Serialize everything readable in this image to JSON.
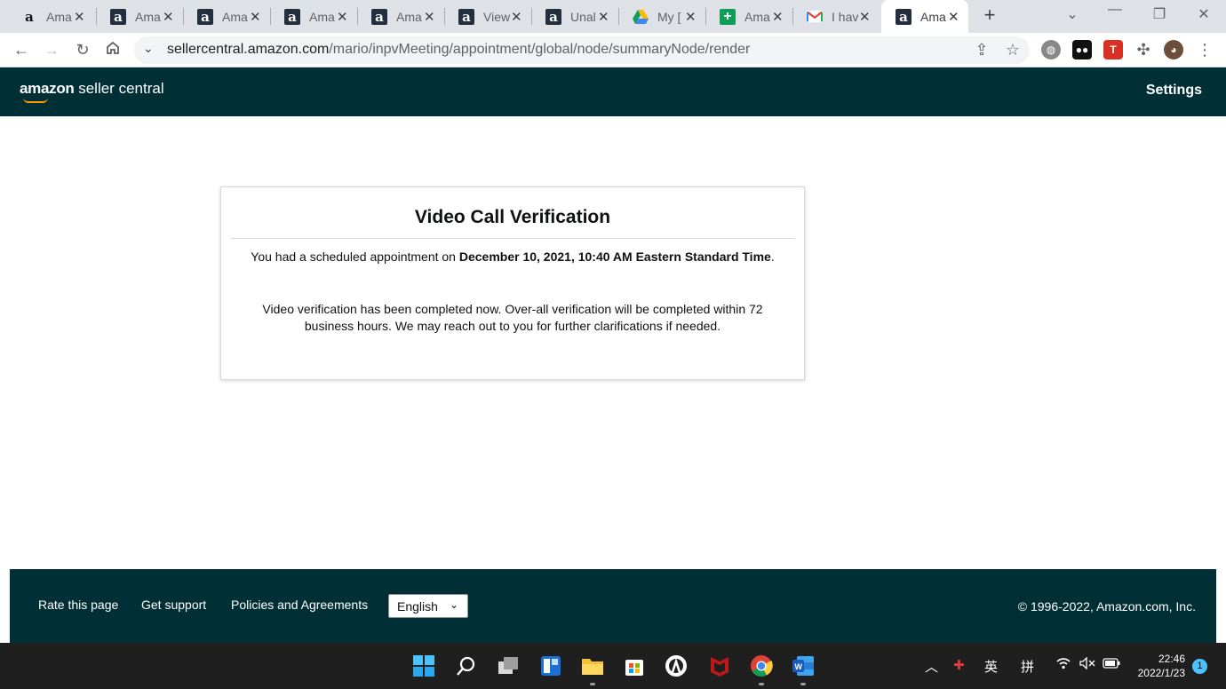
{
  "browser": {
    "tabs": [
      {
        "title": "Ama",
        "icon": "amazon-icon"
      },
      {
        "title": "Ama",
        "icon": "amazon-icon"
      },
      {
        "title": "Ama",
        "icon": "amazon-icon"
      },
      {
        "title": "Ama",
        "icon": "amazon-icon"
      },
      {
        "title": "Ama",
        "icon": "amazon-icon"
      },
      {
        "title": "View",
        "icon": "amazon-icon"
      },
      {
        "title": "Unal",
        "icon": "amazon-icon"
      },
      {
        "title": "My [",
        "icon": "google-drive-icon"
      },
      {
        "title": "Ama",
        "icon": "google-sheets-icon"
      },
      {
        "title": "I hav",
        "icon": "gmail-icon"
      },
      {
        "title": "Ama",
        "icon": "amazon-icon"
      }
    ],
    "url_host": "sellercentral.amazon.com",
    "url_path": "/mario/inpvMeeting/appointment/global/node/summaryNode/render"
  },
  "header": {
    "logo_bold": "amazon",
    "logo_rest": " seller central",
    "settings_label": "Settings"
  },
  "card": {
    "title": "Video Call Verification",
    "p1_prefix": "You had a scheduled appointment on ",
    "p1_bold": "December 10, 2021, 10:40 AM Eastern Standard Time",
    "p1_suffix": ".",
    "p2": "Video verification has been completed now. Over-all verification will be completed within 72 business hours. We may reach out to you for further clarifications if needed."
  },
  "footer": {
    "rate": "Rate this page",
    "support": "Get support",
    "policies": "Policies and Agreements",
    "language": "English",
    "copyright": "© 1996-2022, Amazon.com, Inc."
  },
  "taskbar": {
    "ime_1": "英",
    "ime_2": "拼",
    "time": "22:46",
    "date": "2022/1/23",
    "notifications": "1"
  },
  "colors": {
    "header_bg": "#002f36",
    "accent_orange": "#ff9900"
  }
}
